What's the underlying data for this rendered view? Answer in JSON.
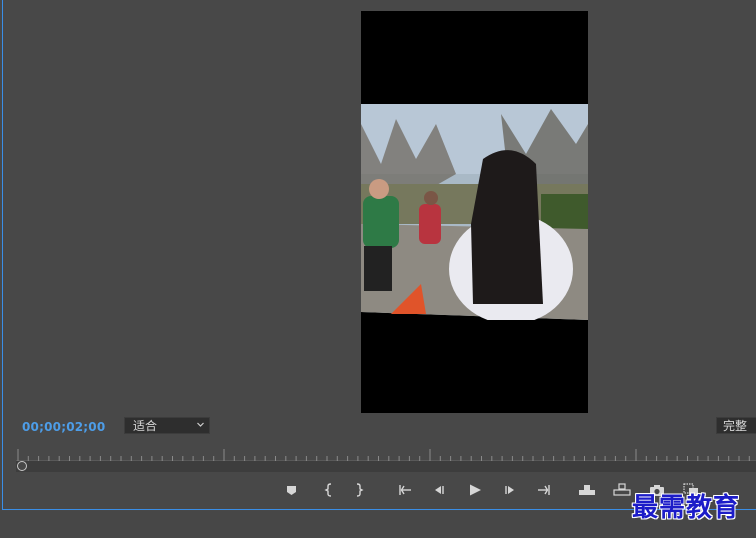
{
  "program_monitor": {
    "timecode": "00;00;02;00",
    "zoom_select": {
      "selected": "适合"
    },
    "quality_select": {
      "selected": "完整"
    }
  },
  "transport": {
    "icons": [
      "add-marker-icon",
      "mark-in-icon",
      "mark-out-icon",
      "go-to-in-icon",
      "step-back-icon",
      "play-icon",
      "step-forward-icon",
      "go-to-out-icon",
      "lift-icon",
      "extract-icon",
      "export-frame-icon",
      "comparison-view-icon"
    ]
  },
  "watermark": {
    "text": "最需教育"
  },
  "colors": {
    "accent": "#3a8ee6",
    "timecode": "#4d9de8",
    "panel_bg": "#484848"
  }
}
